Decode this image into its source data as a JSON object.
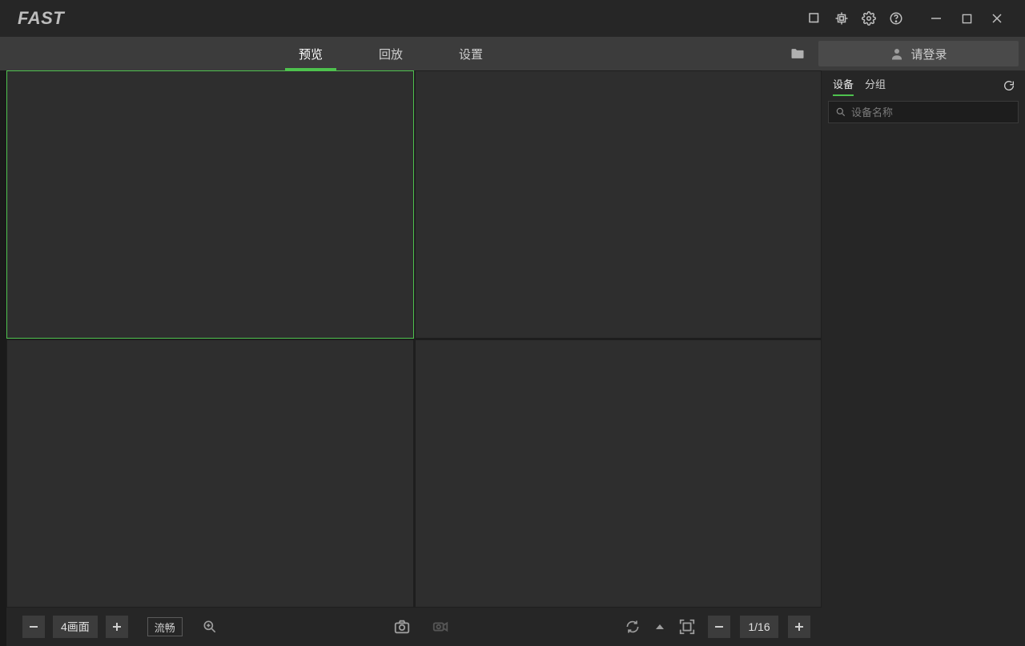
{
  "app": {
    "name": "FAST"
  },
  "titlebar_icons": {
    "screenshot": "screenshot-icon",
    "cpu": "cpu-icon",
    "settings": "gear-icon",
    "help": "help-icon",
    "minimize": "minimize",
    "maximize": "maximize",
    "close": "close"
  },
  "tabs": {
    "preview": "预览",
    "playback": "回放",
    "settings": "设置",
    "active": "preview"
  },
  "login_label": "请登录",
  "sidebar": {
    "device_tab": "设备",
    "group_tab": "分组",
    "active": "device",
    "search_placeholder": "设备名称"
  },
  "bottombar": {
    "layout_label": "4画面",
    "stream_label": "流畅",
    "page_label": "1/16"
  }
}
